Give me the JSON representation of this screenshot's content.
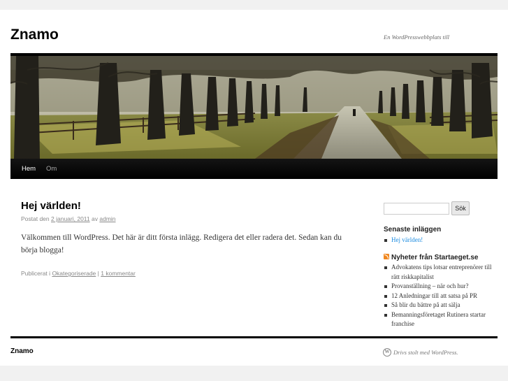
{
  "header": {
    "site_title": "Znamo",
    "site_description": "En WordPresswebbplats till"
  },
  "nav": {
    "items": [
      {
        "label": "Hem",
        "current": true
      },
      {
        "label": "Om",
        "current": false
      }
    ]
  },
  "post": {
    "title": "Hej världen!",
    "meta_prefix": "Postat den",
    "date": "2 januari, 2011",
    "by_word": "av",
    "author": "admin",
    "content": "Välkommen till WordPress. Det här är ditt första inlägg. Redigera det eller radera det. Sedan kan du börja blogga!",
    "utility_prefix": "Publicerat i",
    "category": "Okategoriserade",
    "separator": "|",
    "comments": "1 kommentar"
  },
  "sidebar": {
    "search_placeholder": "",
    "search_button": "Sök",
    "recent_title": "Senaste inläggen",
    "recent_posts": [
      "Hej världen!"
    ],
    "news_title": "Nyheter från Startaeget.se",
    "news_items": [
      "Advokatens tips lotsar entreprenörer till rätt riskkapitalist",
      "Provanställning – när och hur?",
      "12 Anledningar till att satsa på PR",
      "Så blir du bättre på att sälja",
      "Bemanningsföretaget Rutinera startar franchise"
    ]
  },
  "footer": {
    "site_name": "Znamo",
    "credit": "Drivs stolt med WordPress."
  },
  "colors": {
    "link_blue": "#1b8be0",
    "menu_bar": "#000000",
    "rss_orange": "#f0871f"
  }
}
